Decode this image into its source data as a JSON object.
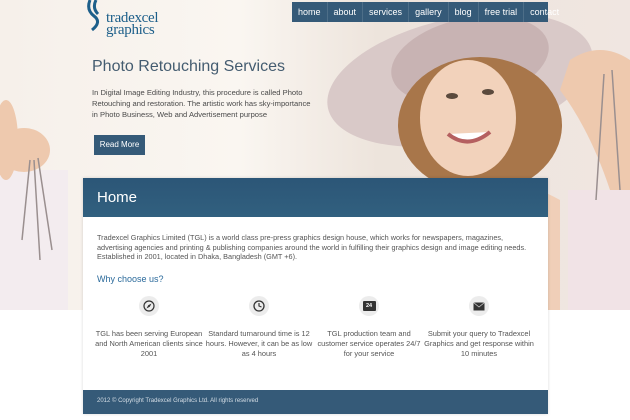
{
  "brand": {
    "logo_line1": "tradexcel",
    "logo_line2": "graphics"
  },
  "nav": {
    "items": [
      {
        "label": "home"
      },
      {
        "label": "about"
      },
      {
        "label": "services"
      },
      {
        "label": "gallery"
      },
      {
        "label": "blog"
      },
      {
        "label": "free trial"
      },
      {
        "label": "contact"
      }
    ]
  },
  "hero": {
    "title": "Photo Retouching Services",
    "description": "In Digital Image Editing Industry, this procedure is called Photo Retouching and restoration. The artistic work has sky-importance in Photo Business, Web and Advertisement purpose",
    "button_label": "Read More"
  },
  "content": {
    "title": "Home",
    "intro": "Tradexcel Graphics Limited (TGL) is a world class pre-press graphics design house, which works for newspapers, magazines, advertising agencies and printing & publishing companies around the world in fulfilling their graphics design and image editing needs. Established in 2001, located in Dhaka, Bangladesh (GMT +6).",
    "why_heading": "Why choose us?",
    "features": [
      {
        "icon": "compass-icon",
        "text": "TGL has been serving European and North American clients since 2001"
      },
      {
        "icon": "clock-icon",
        "text": "Standard turnaround time is 12 hours. However, it can be as low as 4 hours"
      },
      {
        "icon": "24-hour-icon",
        "text": "TGL production team and customer service operates 24/7 for your service"
      },
      {
        "icon": "envelope-icon",
        "text": "Submit your query to Tradexcel Graphics and get response within 10 minutes"
      }
    ],
    "badge_24": "24"
  },
  "footer": {
    "copyright": "2012 © Copyright Tradexcel Graphics Ltd. All rights reserved"
  },
  "colors": {
    "accent": "#355a78",
    "link": "#2b6a9b"
  }
}
